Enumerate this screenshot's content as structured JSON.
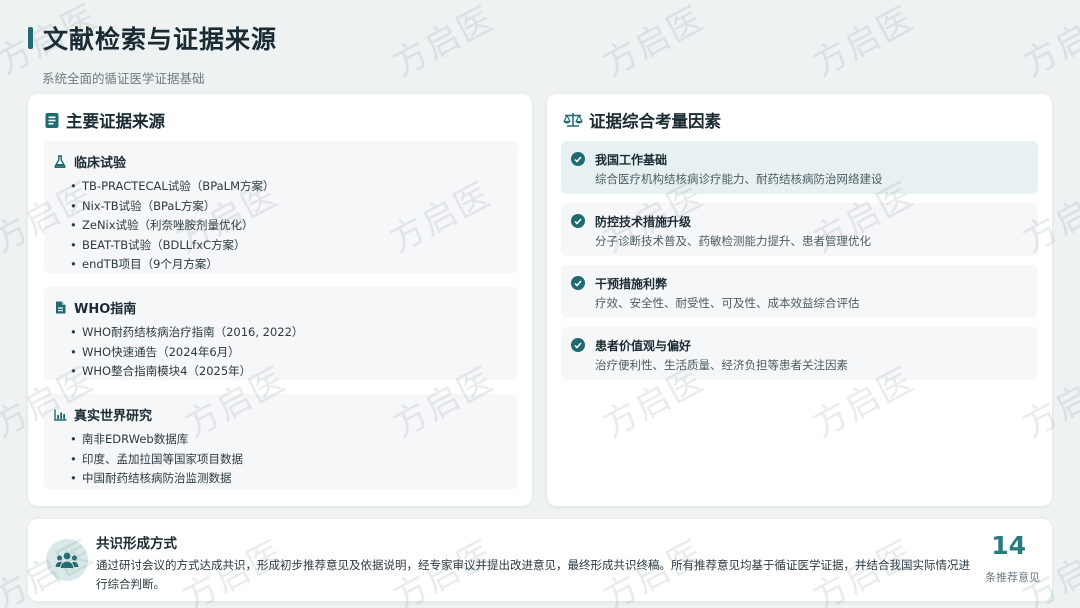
{
  "header": {
    "title": "文献检索与证据来源",
    "subtitle": "系统全面的循证医学证据基础"
  },
  "left_panel": {
    "title": "主要证据来源",
    "icon": "book-icon",
    "sections": [
      {
        "title": "临床试验",
        "icon": "flask-icon",
        "items": [
          "TB-PRACTECAL试验（BPaLM方案）",
          "Nix-TB试验（BPaL方案）",
          "ZeNix试验（利奈唑胺剂量优化）",
          "BEAT-TB试验（BDLLfxC方案）",
          "endTB项目（9个月方案）"
        ]
      },
      {
        "title": "WHO指南",
        "icon": "file-icon",
        "items": [
          "WHO耐药结核病治疗指南（2016, 2022）",
          "WHO快速通告（2024年6月）",
          "WHO整合指南模块4（2025年）"
        ]
      },
      {
        "title": "真实世界研究",
        "icon": "bar-chart-icon",
        "items": [
          "南非EDRWeb数据库",
          "印度、孟加拉国等国家项目数据",
          "中国耐药结核病防治监测数据"
        ]
      }
    ]
  },
  "right_panel": {
    "title": "证据综合考量因素",
    "icon": "scale-icon",
    "factors": [
      {
        "title": "我国工作基础",
        "desc": "综合医疗机构结核病诊疗能力、耐药结核病防治网络建设"
      },
      {
        "title": "防控技术措施升级",
        "desc": "分子诊断技术普及、药敏检测能力提升、患者管理优化"
      },
      {
        "title": "干预措施利弊",
        "desc": "疗效、安全性、耐受性、可及性、成本效益综合评估"
      },
      {
        "title": "患者价值观与偏好",
        "desc": "治疗便利性、生活质量、经济负担等患者关注因素"
      }
    ]
  },
  "consensus": {
    "title": "共识形成方式",
    "icon": "people-icon",
    "text": "通过研讨会议的方式达成共识，形成初步推荐意见及依据说明，经专家审议并提出改进意见，最终形成共识终稿。所有推荐意见均基于循证医学证据，并结合我国实际情况进行综合判断。",
    "stat_value": "14",
    "stat_label": "条推荐意见"
  },
  "watermark": "方启医",
  "colors": {
    "accent": "#1f6b70",
    "stat": "#2a7a7e",
    "background": "#eef2f2"
  }
}
